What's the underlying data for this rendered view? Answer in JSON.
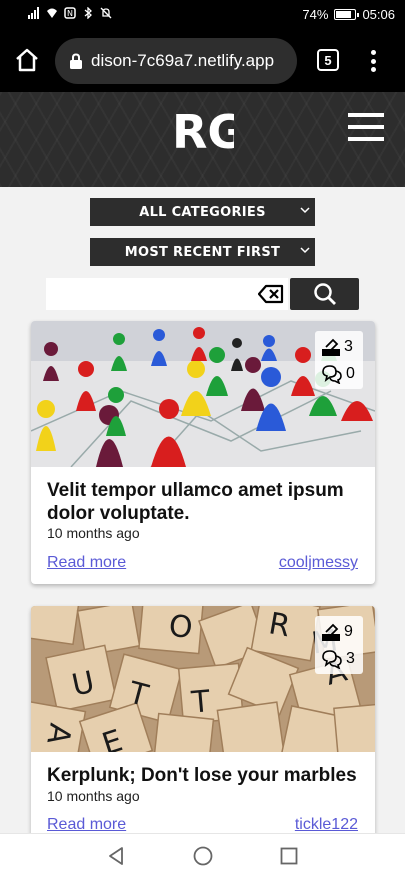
{
  "status_bar": {
    "battery_percent": "74%",
    "battery_level": 0.74,
    "time": "05:06",
    "icons": [
      "signal-icon",
      "wifi-icon",
      "nfc-icon",
      "bluetooth-icon",
      "mute-icon"
    ]
  },
  "browser": {
    "url": "dison-7c69a7.netlify.app",
    "tab_count": "5"
  },
  "site": {
    "logo_text": "RG"
  },
  "filters": {
    "category_select": "All Categories",
    "sort_select": "Most Recent First",
    "search_placeholder": ""
  },
  "cards": [
    {
      "title": "Velit tempor ullamco amet ipsum dolor voluptate.",
      "age": "10 months ago",
      "votes": "3",
      "comments": "0",
      "read_more": "Read more",
      "author": "cooljmessy",
      "image": "board game pawns on network"
    },
    {
      "title": "Kerplunk; Don't lose your marbles",
      "age": "10 months ago",
      "votes": "9",
      "comments": "3",
      "read_more": "Read more",
      "author": "tickle122",
      "image": "scrabble tiles"
    }
  ],
  "colors": {
    "header_bg": "#2d2d2d",
    "link": "#5a5ad6",
    "page_bg": "#f2f2f2"
  }
}
